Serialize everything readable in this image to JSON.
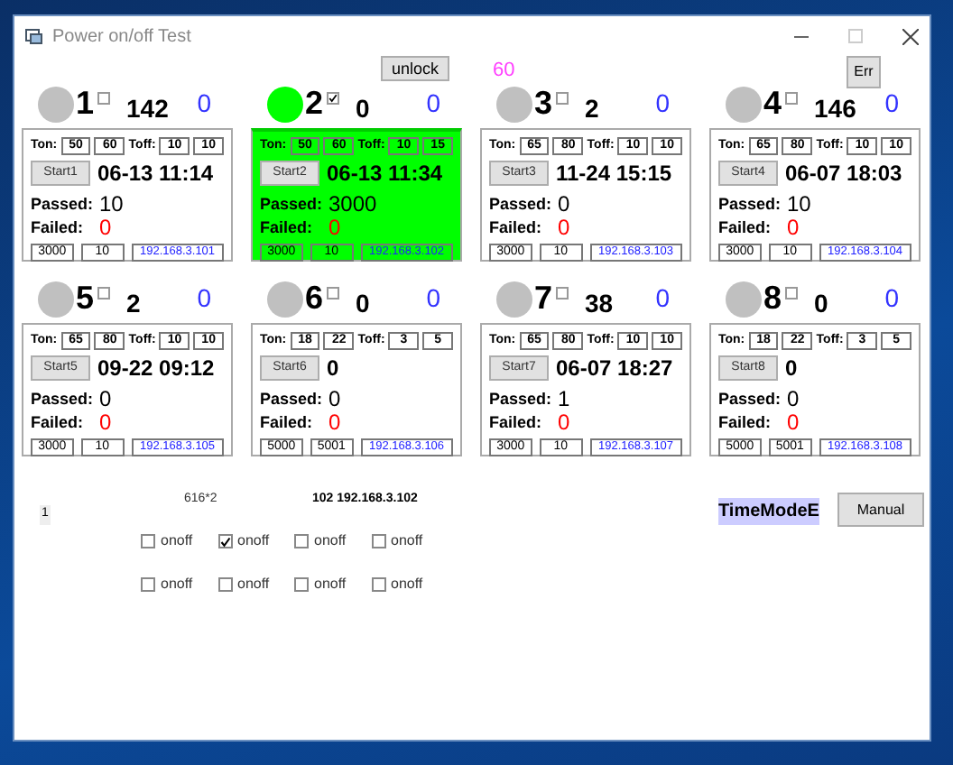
{
  "window": {
    "title": "Power on/off Test"
  },
  "unlock_button": "unlock",
  "counter": "60",
  "err_button": "Err",
  "channels": [
    {
      "number": "1",
      "checked": false,
      "active": false,
      "count": "142",
      "errors": "0",
      "ton": [
        "50",
        "60"
      ],
      "toff": [
        "10",
        "10"
      ],
      "start": "Start1",
      "time": "06-13 11:14",
      "passed": "10",
      "failed": "0",
      "fields": [
        "3000",
        "10"
      ],
      "ip": "192.168.3.101"
    },
    {
      "number": "2",
      "checked": true,
      "active": true,
      "count": "0",
      "errors": "0",
      "ton": [
        "50",
        "60"
      ],
      "toff": [
        "10",
        "15"
      ],
      "start": "Start2",
      "time": "06-13 11:34",
      "passed": "3000",
      "failed": "0",
      "fields": [
        "3000",
        "10"
      ],
      "ip": "192.168.3.102"
    },
    {
      "number": "3",
      "checked": false,
      "active": false,
      "count": "2",
      "errors": "0",
      "ton": [
        "65",
        "80"
      ],
      "toff": [
        "10",
        "10"
      ],
      "start": "Start3",
      "time": "11-24 15:15",
      "passed": "0",
      "failed": "0",
      "fields": [
        "3000",
        "10"
      ],
      "ip": "192.168.3.103"
    },
    {
      "number": "4",
      "checked": false,
      "active": false,
      "count": "146",
      "errors": "0",
      "ton": [
        "65",
        "80"
      ],
      "toff": [
        "10",
        "10"
      ],
      "start": "Start4",
      "time": "06-07 18:03",
      "passed": "10",
      "failed": "0",
      "fields": [
        "3000",
        "10"
      ],
      "ip": "192.168.3.104"
    },
    {
      "number": "5",
      "checked": false,
      "active": false,
      "count": "2",
      "errors": "0",
      "ton": [
        "65",
        "80"
      ],
      "toff": [
        "10",
        "10"
      ],
      "start": "Start5",
      "time": "09-22 09:12",
      "passed": "0",
      "failed": "0",
      "fields": [
        "3000",
        "10"
      ],
      "ip": "192.168.3.105"
    },
    {
      "number": "6",
      "checked": false,
      "active": false,
      "count": "0",
      "errors": "0",
      "ton": [
        "18",
        "22"
      ],
      "toff": [
        "3",
        "5"
      ],
      "start": "Start6",
      "time": "0",
      "passed": "0",
      "failed": "0",
      "fields": [
        "5000",
        "5001"
      ],
      "ip": "192.168.3.106"
    },
    {
      "number": "7",
      "checked": false,
      "active": false,
      "count": "38",
      "errors": "0",
      "ton": [
        "65",
        "80"
      ],
      "toff": [
        "10",
        "10"
      ],
      "start": "Start7",
      "time": "06-07 18:27",
      "passed": "1",
      "failed": "0",
      "fields": [
        "3000",
        "10"
      ],
      "ip": "192.168.3.107"
    },
    {
      "number": "8",
      "checked": false,
      "active": false,
      "count": "0",
      "errors": "0",
      "ton": [
        "18",
        "22"
      ],
      "toff": [
        "3",
        "5"
      ],
      "start": "Start8",
      "time": "0",
      "passed": "0",
      "failed": "0",
      "fields": [
        "5000",
        "5001"
      ],
      "ip": "192.168.3.108"
    }
  ],
  "labels": [
    {
      "ton": "Ton:",
      "toff": "Toff:",
      "passed": "Passed:",
      "failed": "Failed:"
    },
    {
      "ton": "Ton:",
      "toff": "Toff:",
      "passed": "Passed:",
      "failed": "Failed:"
    },
    {
      "ton": "Ton:",
      "toff": "Toff:",
      "passed": "Passed:",
      "failed": "Failed:"
    },
    {
      "ton": "Ton:",
      "toff": "Toff:",
      "passed": "Passed:",
      "failed": "Failed:"
    },
    {
      "ton": "Ton:",
      "toff": "Toff:",
      "passed": "Passed:",
      "failed": "Failed:"
    },
    {
      "ton": "Ton:",
      "toff": "Toff:",
      "passed": "Passed:",
      "failed": "Failed:"
    },
    {
      "ton": "Ton:",
      "toff": "Toff:",
      "passed": "Passed:",
      "failed": "Failed:"
    },
    {
      "ton": "Ton:",
      "toff": "Toff:",
      "passed": "Passed:",
      "failed": "Failed:"
    }
  ],
  "status": {
    "index": "1",
    "size": "616*2",
    "selected_ip": "102 192.168.3.102",
    "mode": "TimeModeE",
    "manual_button": "Manual"
  },
  "onoff": [
    {
      "label": "onoff",
      "checked": false
    },
    {
      "label": "onoff",
      "checked": true
    },
    {
      "label": "onoff",
      "checked": false
    },
    {
      "label": "onoff",
      "checked": false
    },
    {
      "label": "onoff",
      "checked": false
    },
    {
      "label": "onoff",
      "checked": false
    },
    {
      "label": "onoff",
      "checked": false
    },
    {
      "label": "onoff",
      "checked": false
    }
  ]
}
